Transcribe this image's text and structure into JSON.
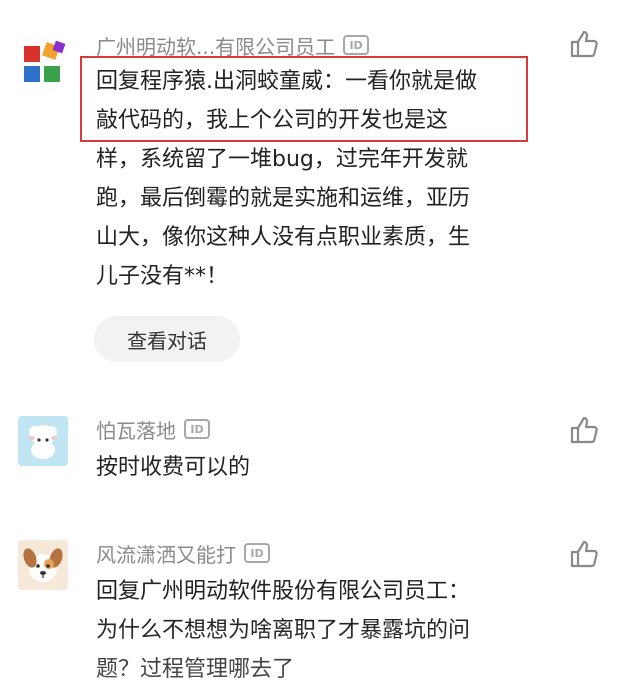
{
  "comments": [
    {
      "username": "广州明动软...有限公司员工",
      "id_badge": "ID",
      "text": "回复程序猿.出洞蛟童威：一看你就是做敲代码的，我上个公司的开发也是这样，系统留了一堆bug，过完年开发就跑，最后倒霉的就是实施和运维，亚历山大，像你这种人没有点职业素质，生儿子没有**！",
      "lines": [
        "回复程序猿.出洞蛟童威：一看你就是做",
        "敲代码的，我上个公司的开发也是这",
        "样，系统留了一堆bug，过完年开发就",
        "跑，最后倒霉的就是实施和运维，亚历",
        "山大，像你这种人没有点职业素质，生",
        "儿子没有**！"
      ],
      "view_conversation": "查看对话"
    },
    {
      "username": "怕瓦落地",
      "id_badge": "ID",
      "lines": [
        "按时收费可以的"
      ]
    },
    {
      "username": "风流潇洒又能打",
      "id_badge": "ID",
      "lines": [
        "回复广州明动软件股份有限公司员工：",
        "为什么不想想为啥离职了才暴露坑的问",
        "题？过程管理哪去了"
      ]
    }
  ],
  "colors": {
    "highlight_border": "#d93a3a",
    "username": "#8a8a8a",
    "text": "#222222",
    "pill_bg": "#f2f2f2"
  },
  "icons": {
    "like": "thumbs-up-icon",
    "id": "id-badge-icon"
  }
}
